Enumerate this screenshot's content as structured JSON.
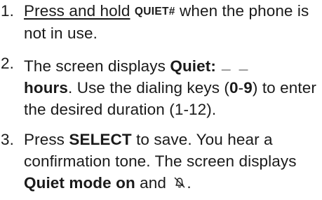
{
  "steps": [
    {
      "number": "1.",
      "action": "Press and hold",
      "key": "QUIET#",
      "rest": " when the phone is not in use."
    },
    {
      "number": "2.",
      "pre": "The screen displays ",
      "display": "Quiet:",
      "blanks": "_ _",
      "display2": "hours",
      "mid": ". Use the dialing keys (",
      "range_start": "0",
      "dash": "-",
      "range_end": "9",
      "post": ") to enter the desired duration (1-12)."
    },
    {
      "number": "3.",
      "pre": "Press ",
      "key": "SELECT",
      "mid": " to save. You hear a confirmation tone. The screen displays ",
      "display": "Quiet mode on",
      "and": " and ",
      "end": ".",
      "icon": "quiet-bell-icon"
    }
  ]
}
